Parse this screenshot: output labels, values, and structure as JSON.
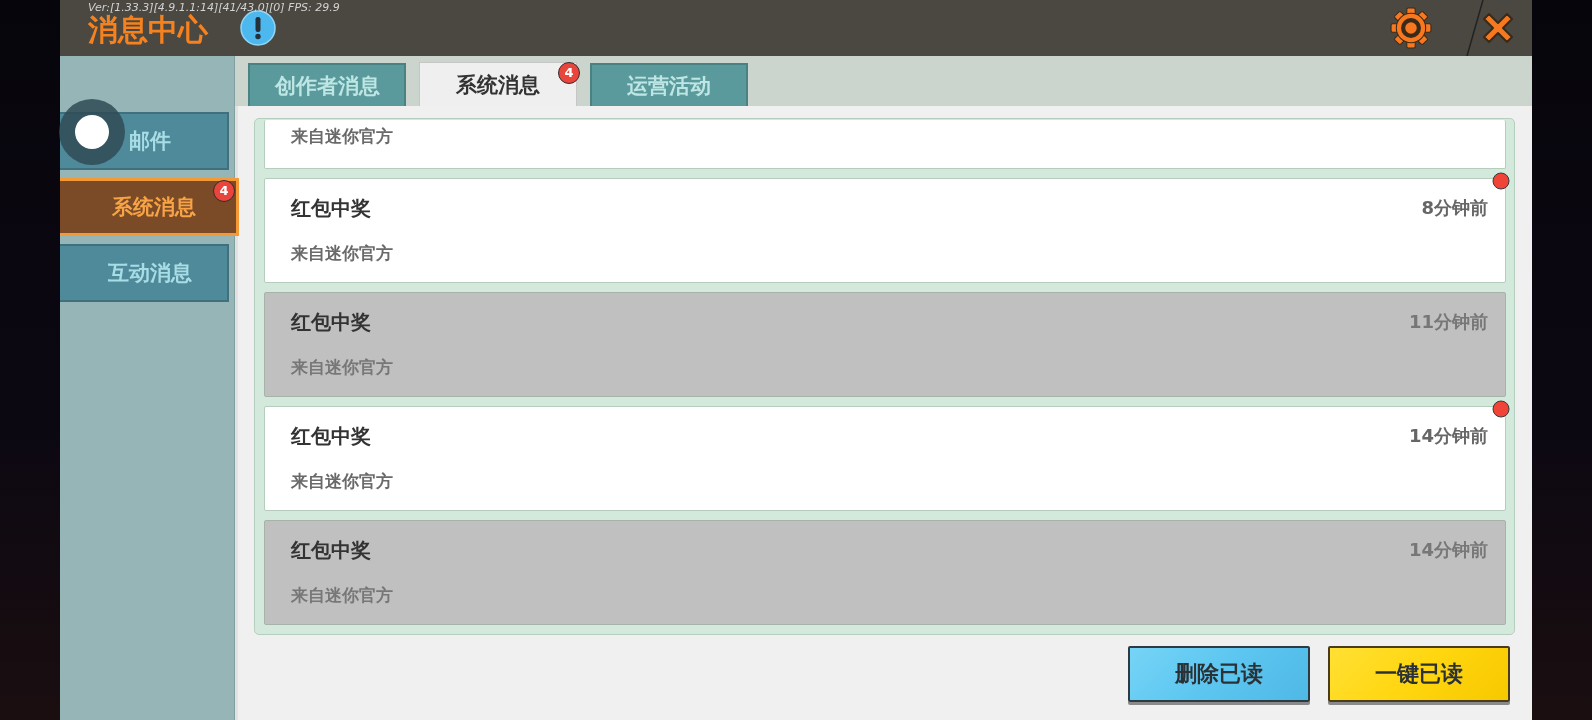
{
  "header": {
    "version": "Ver:[1.33.3][4.9.1.1:14][41/43,0][0] FPS: 29.9",
    "title": "消息中心"
  },
  "sidebar": {
    "items": [
      {
        "label": "邮件",
        "selected": false
      },
      {
        "label": "系统消息",
        "selected": true,
        "badge": "4"
      },
      {
        "label": "互动消息",
        "selected": false
      }
    ]
  },
  "tabs": [
    {
      "label": "创作者消息",
      "selected": false
    },
    {
      "label": "系统消息",
      "selected": true,
      "badge": "4"
    },
    {
      "label": "运营活动",
      "selected": false
    }
  ],
  "messages": [
    {
      "kind": "clipped",
      "source": "来自迷你官方",
      "read": false
    },
    {
      "kind": "full",
      "title": "红包中奖",
      "time": "8分钟前",
      "source": "来自迷你官方",
      "read": false
    },
    {
      "kind": "full",
      "title": "红包中奖",
      "time": "11分钟前",
      "source": "来自迷你官方",
      "read": true
    },
    {
      "kind": "full",
      "title": "红包中奖",
      "time": "14分钟前",
      "source": "来自迷你官方",
      "read": false
    },
    {
      "kind": "full",
      "title": "红包中奖",
      "time": "14分钟前",
      "source": "来自迷你官方",
      "read": true
    }
  ],
  "buttons": [
    {
      "label": "删除已读",
      "kind": "secondary"
    },
    {
      "label": "一键已读",
      "kind": "primary"
    }
  ]
}
